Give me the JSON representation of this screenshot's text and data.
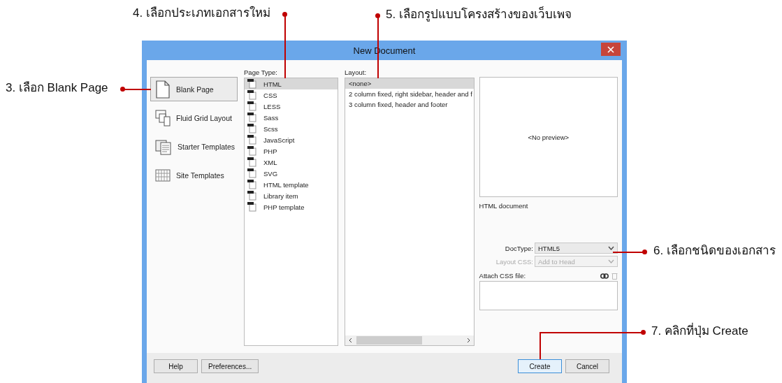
{
  "window": {
    "title": "New Document"
  },
  "categories": [
    {
      "label": "Blank Page",
      "selected": true,
      "kind": "blank"
    },
    {
      "label": "Fluid Grid Layout",
      "selected": false,
      "kind": "fluid"
    },
    {
      "label": "Starter Templates",
      "selected": false,
      "kind": "starter"
    },
    {
      "label": "Site Templates",
      "selected": false,
      "kind": "site"
    }
  ],
  "page_type": {
    "label": "Page Type:",
    "items": [
      {
        "label": "HTML",
        "selected": true
      },
      {
        "label": "CSS",
        "selected": false
      },
      {
        "label": "LESS",
        "selected": false
      },
      {
        "label": "Sass",
        "selected": false
      },
      {
        "label": "Scss",
        "selected": false
      },
      {
        "label": "JavaScript",
        "selected": false
      },
      {
        "label": "PHP",
        "selected": false
      },
      {
        "label": "XML",
        "selected": false
      },
      {
        "label": "SVG",
        "selected": false
      },
      {
        "label": "HTML template",
        "selected": false
      },
      {
        "label": "Library item",
        "selected": false
      },
      {
        "label": "PHP template",
        "selected": false
      }
    ]
  },
  "layout": {
    "label": "Layout:",
    "items": [
      {
        "label": "<none>",
        "selected": true
      },
      {
        "label": "2 column fixed, right sidebar, header and f",
        "selected": false
      },
      {
        "label": "3 column fixed, header and footer",
        "selected": false
      }
    ]
  },
  "preview": {
    "text": "<No preview>",
    "description": "HTML document"
  },
  "doctype": {
    "label": "DocType:",
    "value": "HTML5",
    "disabled": false
  },
  "layout_css": {
    "label": "Layout CSS:",
    "value": "Add to Head",
    "disabled": true
  },
  "attach_css": {
    "label": "Attach CSS file:"
  },
  "buttons": [
    {
      "label": "Help",
      "kind": "left",
      "focused": false
    },
    {
      "label": "Preferences...",
      "kind": "left",
      "focused": false
    },
    {
      "label": "Create",
      "kind": "right",
      "focused": true
    },
    {
      "label": "Cancel",
      "kind": "right",
      "focused": false
    }
  ],
  "annotations": [
    {
      "text": "3. เลือก Blank Page"
    },
    {
      "text": "4. เลือกประเภทเอกสารใหม่"
    },
    {
      "text": "5. เลือกรูปแบบโครงสร้างของเว็บเพจ"
    },
    {
      "text": "6. เลือกชนิดของเอกสาร"
    },
    {
      "text": "7. คลิกที่ปุ่ม Create"
    }
  ]
}
